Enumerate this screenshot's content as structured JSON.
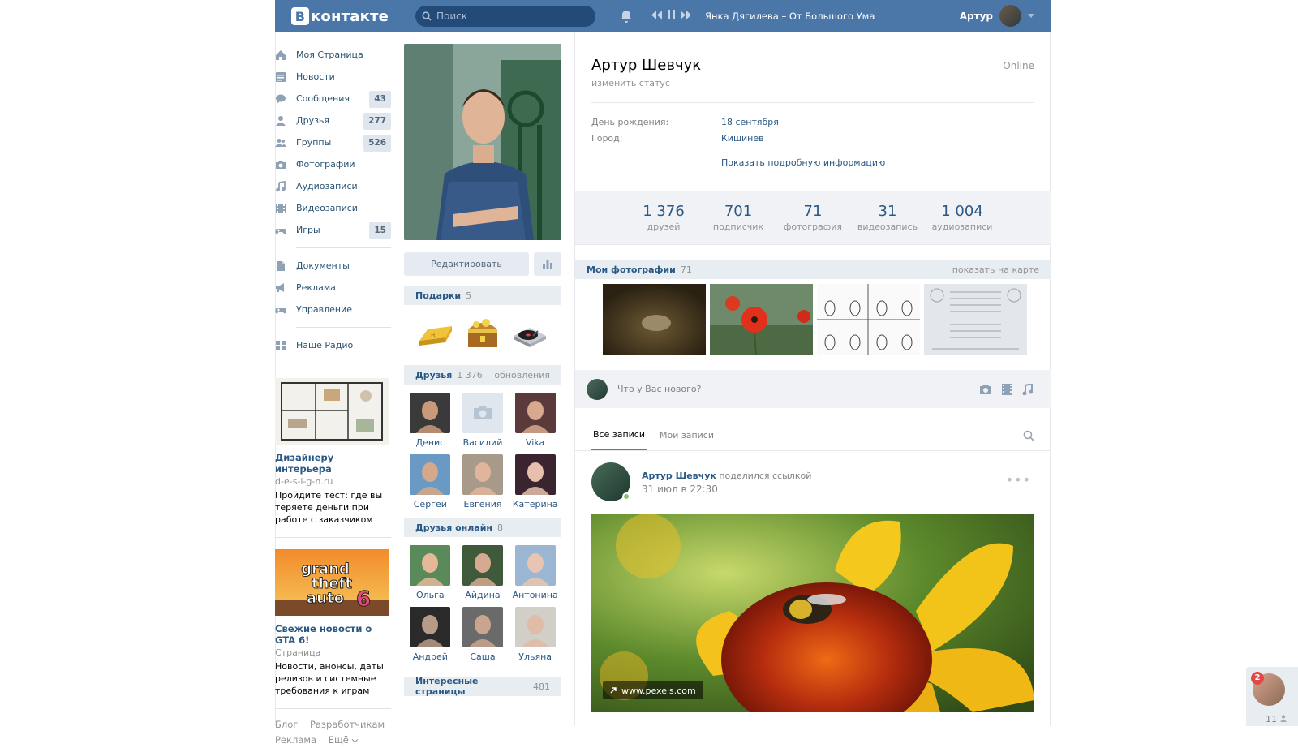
{
  "header": {
    "logo_text": "контакте",
    "logo_letter": "B",
    "search_placeholder": "Поиск",
    "now_playing": "Янка Дягилева – От Большого Ума",
    "user_name": "Артур"
  },
  "sidebar": {
    "items": [
      {
        "label": "Моя Страница",
        "icon": "home-icon",
        "badge": ""
      },
      {
        "label": "Новости",
        "icon": "news-icon",
        "badge": ""
      },
      {
        "label": "Сообщения",
        "icon": "chat-icon",
        "badge": "43"
      },
      {
        "label": "Друзья",
        "icon": "person-icon",
        "badge": "277"
      },
      {
        "label": "Группы",
        "icon": "group-icon",
        "badge": "526"
      },
      {
        "label": "Фотографии",
        "icon": "camera-icon",
        "badge": ""
      },
      {
        "label": "Аудиозаписи",
        "icon": "music-icon",
        "badge": ""
      },
      {
        "label": "Видеозаписи",
        "icon": "film-icon",
        "badge": ""
      },
      {
        "label": "Игры",
        "icon": "gamepad-icon",
        "badge": "15"
      }
    ],
    "items2": [
      {
        "label": "Документы",
        "icon": "document-icon"
      },
      {
        "label": "Реклама",
        "icon": "megaphone-icon"
      },
      {
        "label": "Управление",
        "icon": "gamepad-icon"
      }
    ],
    "items3": [
      {
        "label": "Наше Радио",
        "icon": "grid-icon"
      }
    ],
    "ads": [
      {
        "title": "Дизайнеру интерьера",
        "domain": "d-e-s-i-g-n.ru",
        "text": "Пройдите тест: где вы теряете деньги при работе с заказчиком"
      },
      {
        "title": "Свежие новости о GTA 6!",
        "domain": "Страница",
        "text": "Новости, анонсы, даты релизов и системные требования к играм"
      }
    ],
    "footer": {
      "blog": "Блог",
      "dev": "Разработчикам",
      "ads": "Реклама",
      "more": "Ещё"
    }
  },
  "profile_col": {
    "edit_label": "Редактировать",
    "gifts_title": "Подарки",
    "gifts_count": "5",
    "friends_title": "Друзья",
    "friends_count": "1 376",
    "friends_updates": "обновления",
    "friends": [
      "Денис",
      "Василий",
      "Vika",
      "Сергей",
      "Евгения",
      "Катерина"
    ],
    "online_title": "Друзья онлайн",
    "online_count": "8",
    "online_friends": [
      "Ольга",
      "Айдина",
      "Антонина",
      "Андрей",
      "Саша",
      "Ульяна"
    ],
    "interesting_title": "Интересные страницы",
    "interesting_count": "481"
  },
  "main": {
    "name": "Артур Шевчук",
    "status": "изменить статус",
    "online": "Online",
    "birthday_label": "День рождения:",
    "birthday": "18 сентября",
    "city_label": "Город:",
    "city": "Кишинев",
    "more_info": "Показать подробную информацию",
    "counters": [
      {
        "num": "1 376",
        "label": "друзей"
      },
      {
        "num": "701",
        "label": "подписчик"
      },
      {
        "num": "71",
        "label": "фотография"
      },
      {
        "num": "31",
        "label": "видеозапись"
      },
      {
        "num": "1 004",
        "label": "аудиозаписи"
      }
    ],
    "photos_title": "Мои фотографии",
    "photos_count": "71",
    "photos_map": "показать на карте",
    "new_post_placeholder": "Что у Вас нового?",
    "tabs": [
      "Все записи",
      "Мои записи"
    ],
    "post": {
      "author": "Артур Шевчук",
      "action": "поделился ссылкой",
      "date": "31 июл в 22:30",
      "url": "www.pexels.com"
    }
  },
  "chat": {
    "unread": "2",
    "online": "11"
  }
}
